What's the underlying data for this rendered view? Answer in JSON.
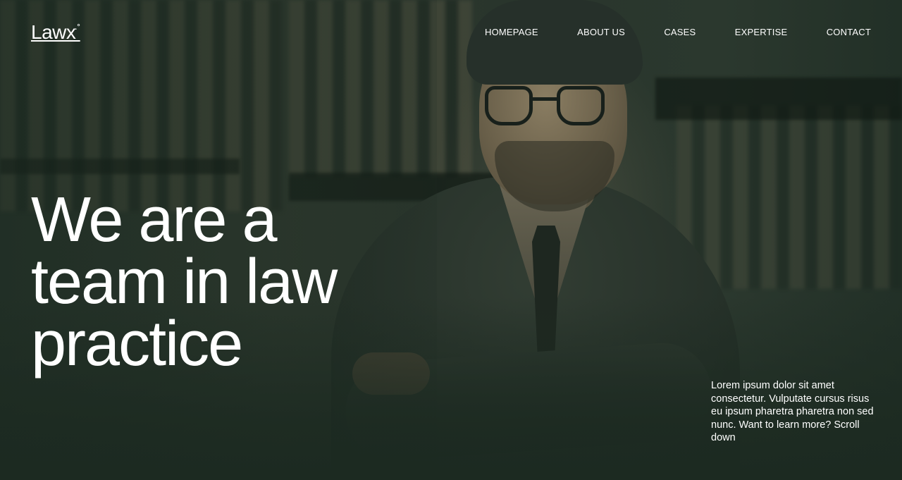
{
  "brand": {
    "logo_text": "Lawx",
    "logo_mark": "·˚"
  },
  "nav": {
    "items": [
      {
        "label": "HOMEPAGE"
      },
      {
        "label": "ABOUT US"
      },
      {
        "label": "CASES"
      },
      {
        "label": "EXPERTISE"
      },
      {
        "label": "CONTACT"
      }
    ]
  },
  "hero": {
    "headline_lines": [
      "We are a",
      "team in law",
      "practice"
    ],
    "intro_text": "Lorem ipsum dolor sit amet consectetur. Vulputate cursus risus eu ipsum pharetra pharetra non sed nunc. Want to learn more? Scroll down"
  },
  "colors": {
    "background": "#1e2d24",
    "text": "#ffffff"
  }
}
